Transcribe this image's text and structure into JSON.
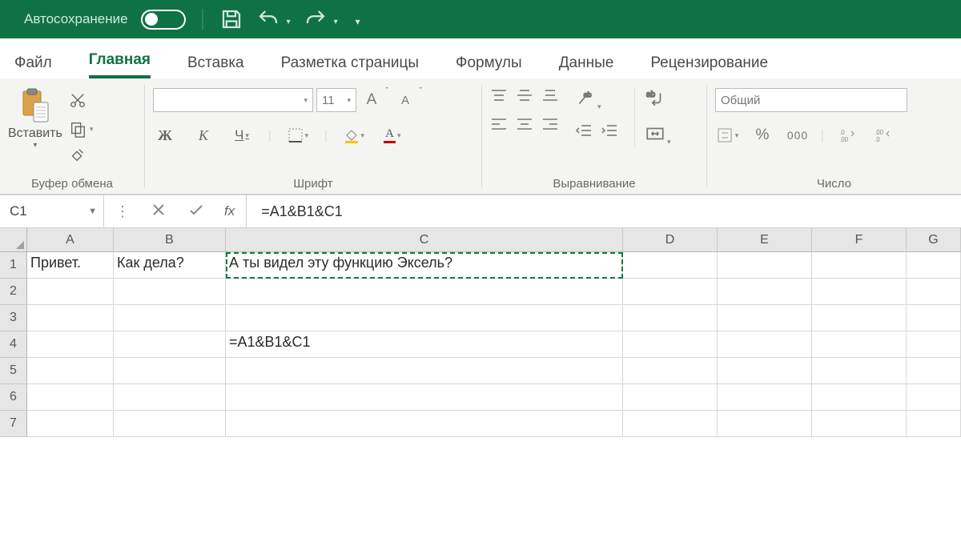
{
  "titlebar": {
    "autosave_label": "Автосохранение"
  },
  "tabs": {
    "file": "Файл",
    "home": "Главная",
    "insert": "Вставка",
    "page_layout": "Разметка страницы",
    "formulas": "Формулы",
    "data": "Данные",
    "review": "Рецензирование"
  },
  "ribbon": {
    "clipboard": {
      "paste_label": "Вставить",
      "group_label": "Буфер обмена"
    },
    "font": {
      "size_value": "11",
      "bold": "Ж",
      "italic": "К",
      "underline": "Ч",
      "increase": "A",
      "decrease": "A",
      "group_label": "Шрифт"
    },
    "alignment": {
      "group_label": "Выравнивание"
    },
    "number": {
      "format_value": "Общий",
      "percent": "%",
      "thousands": "000",
      "group_label": "Число"
    }
  },
  "formula_bar": {
    "name": "C1",
    "fx_label": "fx",
    "formula": "=A1&B1&C1"
  },
  "grid": {
    "columns": [
      "A",
      "B",
      "C",
      "D",
      "E",
      "F",
      "G"
    ],
    "rows": [
      "1",
      "2",
      "3",
      "4",
      "5",
      "6",
      "7"
    ],
    "cells": {
      "A1": "Привет.",
      "B1": "Как дела?",
      "C1": "А ты видел эту функцию Эксель?",
      "C4": "=A1&B1&C1"
    }
  }
}
